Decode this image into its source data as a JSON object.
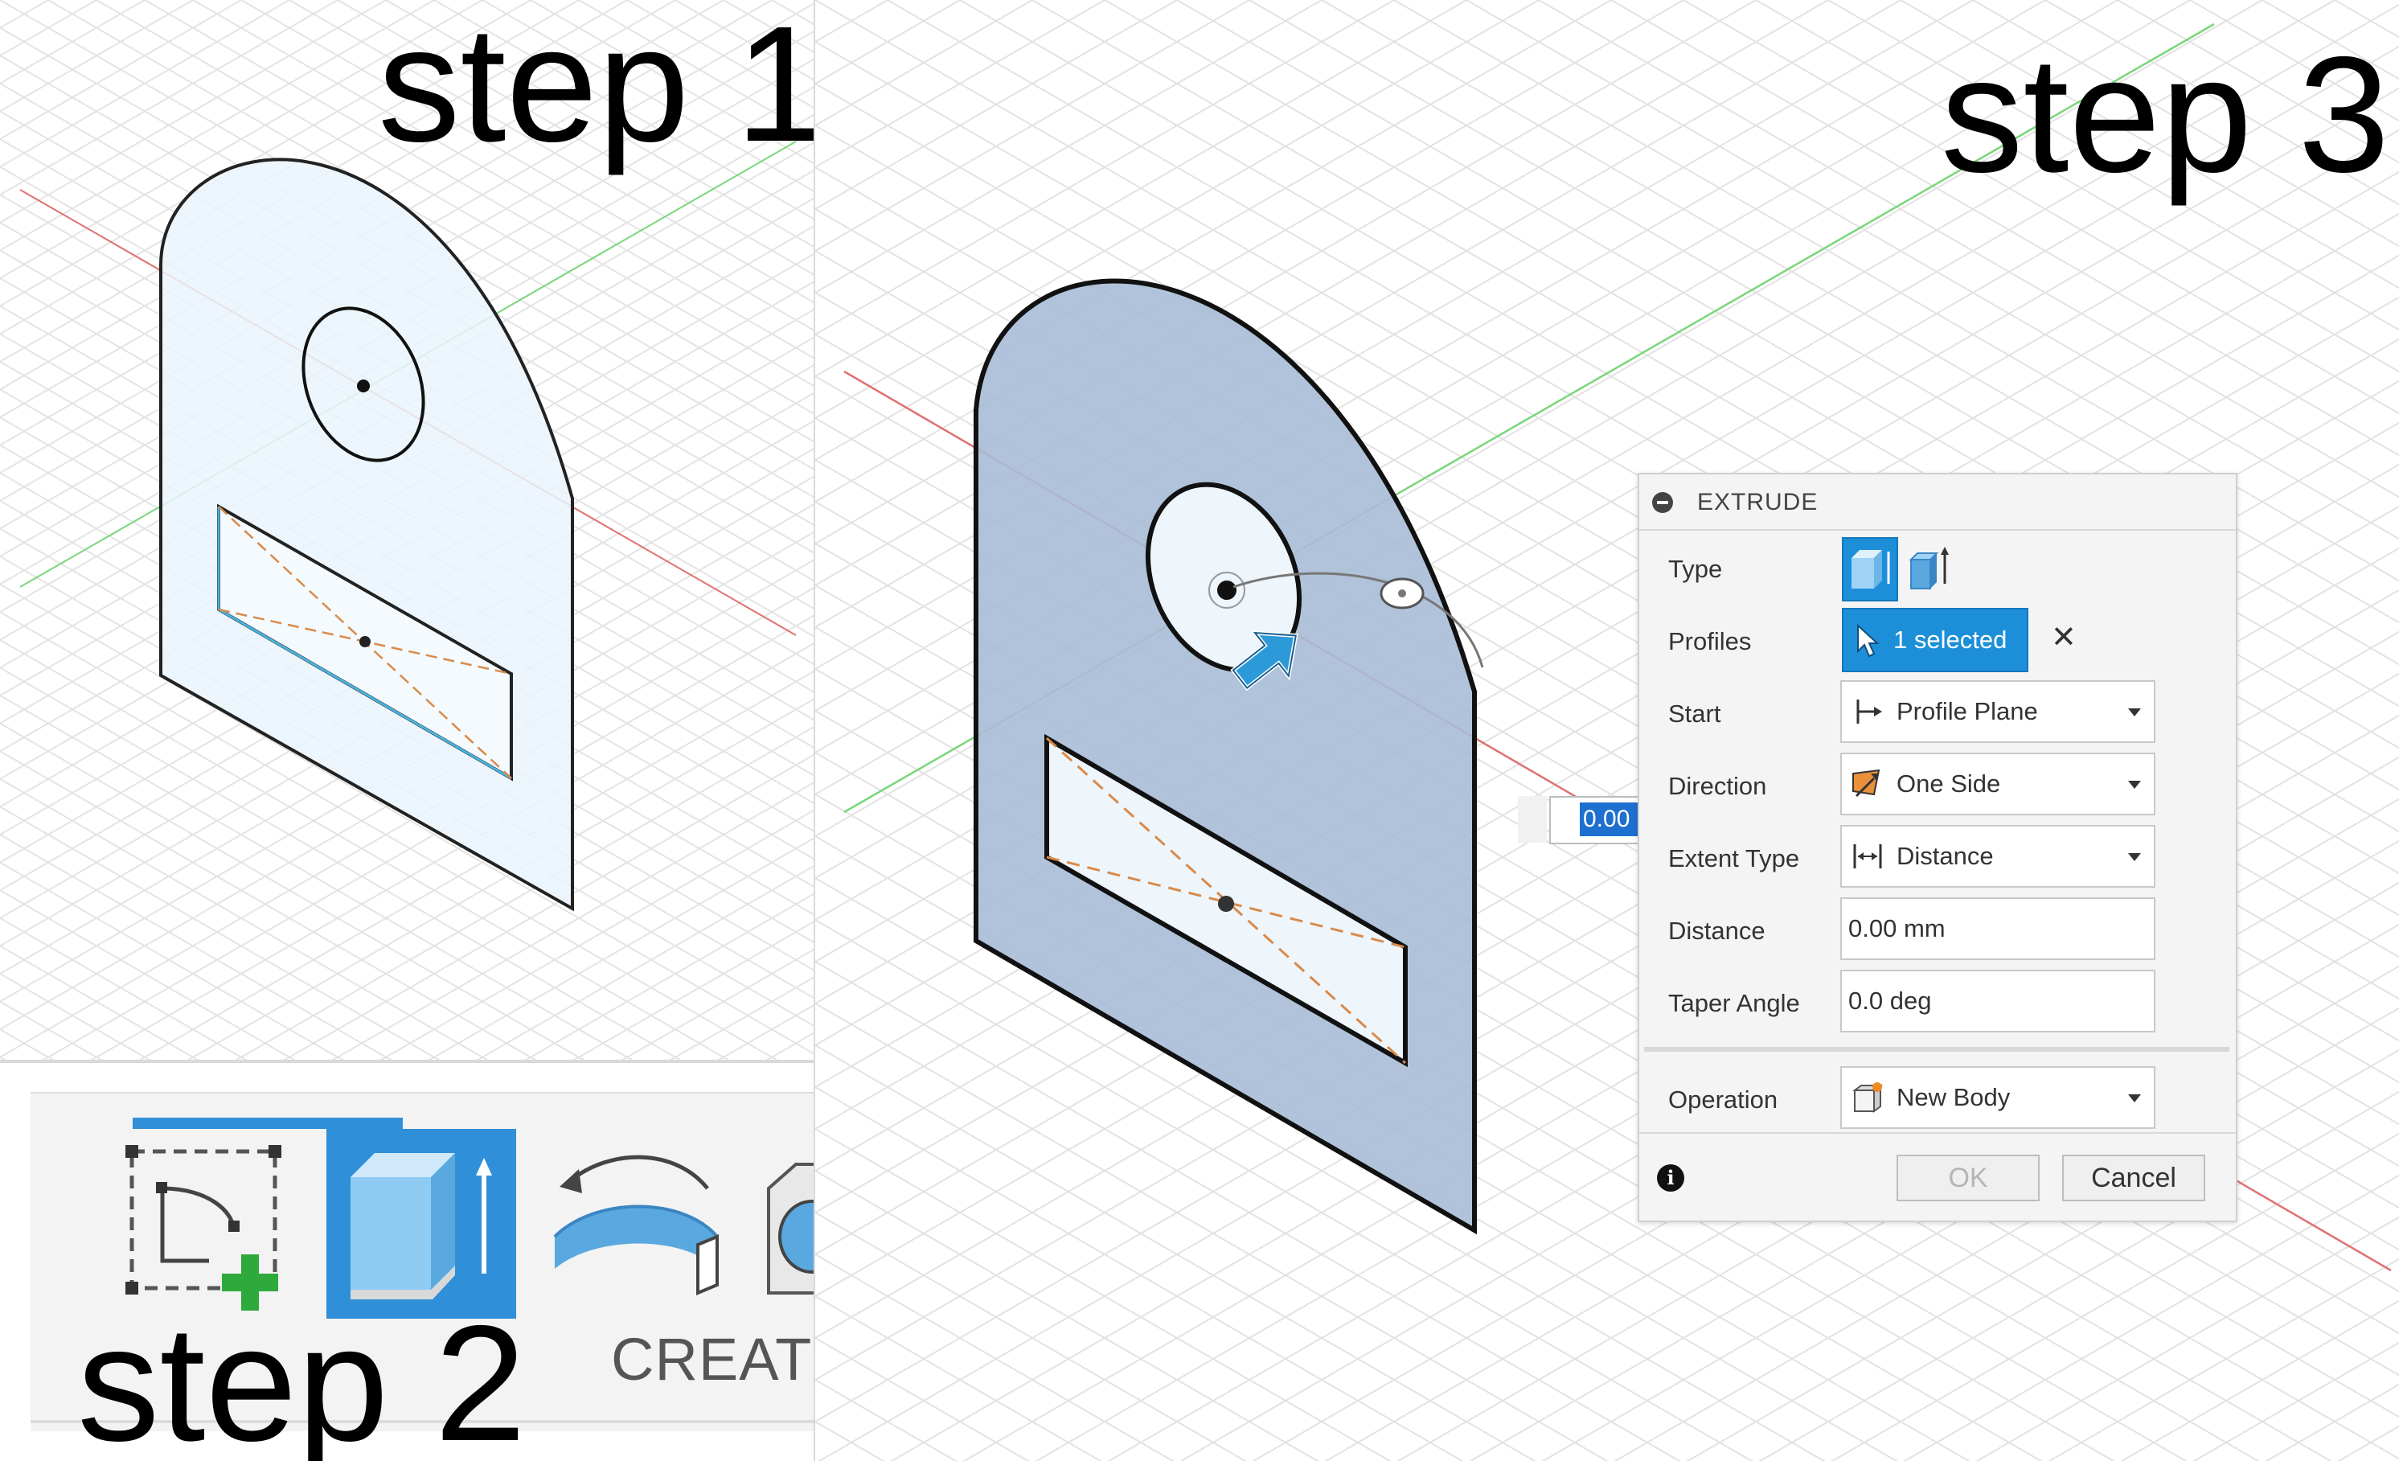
{
  "labels": {
    "step1": "step 1",
    "step2": "step 2",
    "step3": "step 3"
  },
  "toolbar": {
    "section_label": "CREATE",
    "tools": [
      {
        "icon": "create-sketch-icon",
        "active": false
      },
      {
        "icon": "extrude-icon",
        "active": true
      },
      {
        "icon": "revolve-icon",
        "active": false
      },
      {
        "icon": "hole-icon",
        "active": false
      }
    ]
  },
  "dialog": {
    "title": "EXTRUDE",
    "rows": {
      "type": {
        "label": "Type",
        "options": [
          "extrude-solid-icon",
          "extrude-thin-icon"
        ]
      },
      "profiles": {
        "label": "Profiles",
        "value": "1 selected",
        "clear": "✕"
      },
      "start": {
        "label": "Start",
        "value": "Profile Plane"
      },
      "direction": {
        "label": "Direction",
        "value": "One Side"
      },
      "extent_type": {
        "label": "Extent Type",
        "value": "Distance"
      },
      "distance": {
        "label": "Distance",
        "value": "0.00 mm"
      },
      "taper_angle": {
        "label": "Taper Angle",
        "value": "0.0 deg"
      },
      "operation": {
        "label": "Operation",
        "value": "New Body"
      }
    },
    "ok_label": "OK",
    "cancel_label": "Cancel",
    "info": "i"
  },
  "viewport": {
    "distance_input": "0.00 mm"
  },
  "colors": {
    "sketch_fill": "#eaf4fb",
    "profile_fill": "#a9bcd6",
    "selection_blue": "#1d8fd8",
    "axis_x": "#e06060",
    "axis_y": "#6ad06a",
    "construction": "#d98a4a"
  }
}
